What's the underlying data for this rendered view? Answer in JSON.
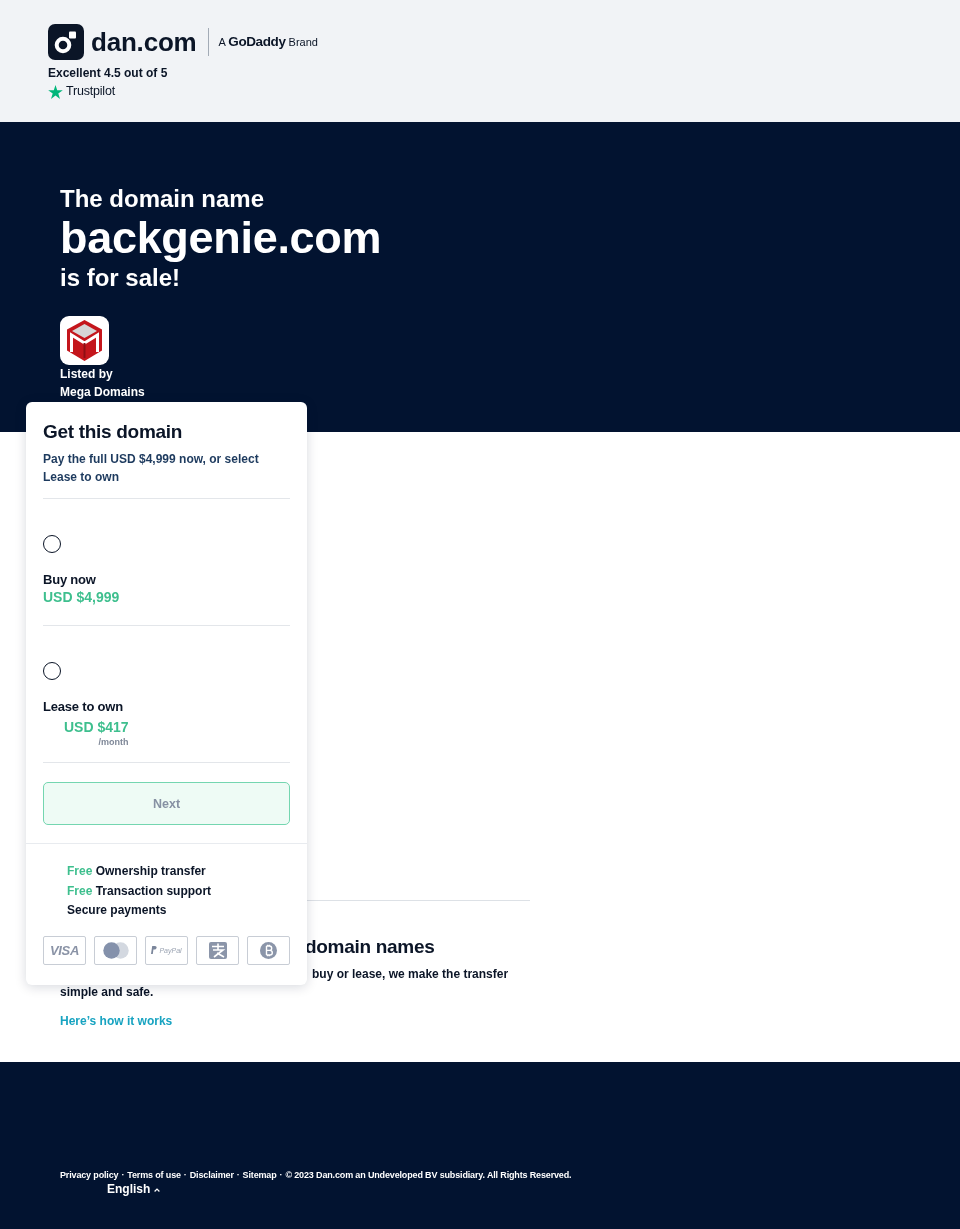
{
  "header": {
    "logo_text": "dan.com",
    "tagline": "A **GoDaddy** Brand",
    "rating": "Excellent 4.5 out of 5",
    "review_site": "Trustpilot"
  },
  "hero": {
    "intro": "The domain name",
    "domain": "backgenie.com",
    "outro": "is for sale!",
    "listed_by_label": "Listed by",
    "seller": "Mega Domains"
  },
  "purchase_card": {
    "title": "Get this domain",
    "subtitle": "Pay the full USD $4,999 now, or select Lease to own",
    "options": [
      {
        "kind": "purchase",
        "label": "Buy now",
        "price": "USD $4,999",
        "selected": false
      },
      {
        "kind": "lease",
        "label": "Lease to own",
        "price": "USD $417",
        "period": "/month",
        "selected": false
      }
    ],
    "next_button": {
      "label": "Next",
      "disabled": true
    },
    "features": [
      {
        "highlight": "Free",
        "text": "Ownership transfer"
      },
      {
        "highlight": "Free",
        "text": "Transaction support"
      },
      {
        "text": "Secure payments"
      }
    ],
    "payment_methods": [
      {
        "kind": "visa",
        "label": "VISA"
      },
      {
        "kind": "mastercard"
      },
      {
        "kind": "paypal",
        "label": "PayPal"
      },
      {
        "kind": "alipay"
      },
      {
        "kind": "bitcoin"
      }
    ]
  },
  "info_section": {
    "heading": "domain names",
    "text_lines": [
      "buy or lease, we make the transfer",
      "simple and safe."
    ],
    "link": "Here’s how it works"
  },
  "footer": {
    "links": [
      "Privacy policy",
      "Terms of use",
      "Disclaimer",
      "Sitemap"
    ],
    "separator": "·",
    "copyright": "© 2023 Dan.com an Undeveloped BV subsidiary. All Rights Reserved.",
    "language": "English"
  }
}
